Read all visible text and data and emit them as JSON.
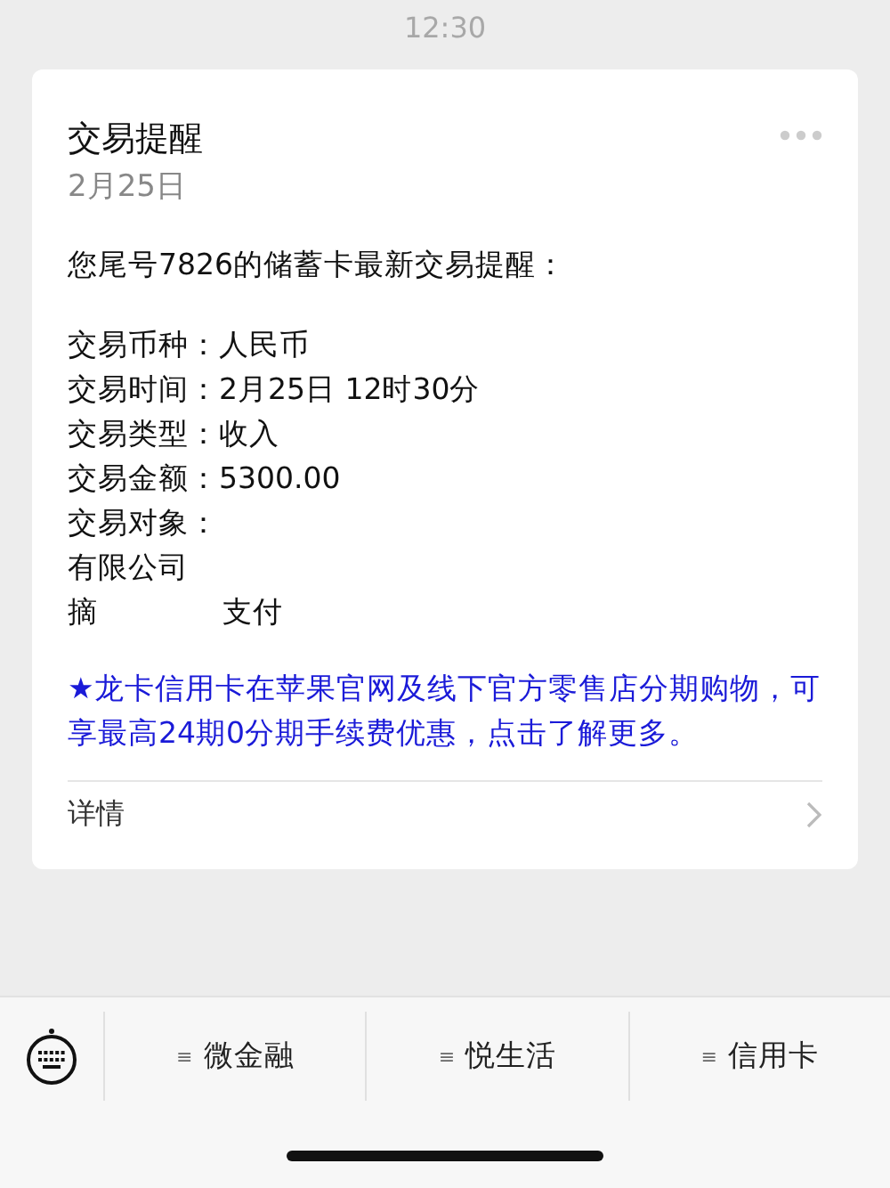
{
  "time": "12:30",
  "message": {
    "title": "交易提醒",
    "date": "2月25日",
    "intro": "您尾号7826的储蓄卡最新交易提醒：",
    "fields": [
      {
        "label": "交易币种：",
        "value": "人民币",
        "kind": "inline"
      },
      {
        "label": "交易时间：",
        "value": "2月25日 12时30分",
        "kind": "inline"
      },
      {
        "label": "交易类型：",
        "value": "收入",
        "kind": "inline"
      },
      {
        "label": "交易金额：",
        "value": "5300.00",
        "kind": "inline"
      },
      {
        "label": "交易对象：",
        "value": "有限公司",
        "kind": "wrapped"
      },
      {
        "label": "摘",
        "value": "支付",
        "kind": "spaced"
      }
    ],
    "promo": "★龙卡信用卡在苹果官网及线下官方零售店分期购物，可享最高24期0分期手续费优惠，点击了解更多。",
    "details": "详情"
  },
  "menu": [
    {
      "glyph": "≡",
      "label": "微金融"
    },
    {
      "glyph": "≡",
      "label": "悦生活"
    },
    {
      "glyph": "≡",
      "label": "信用卡"
    }
  ]
}
